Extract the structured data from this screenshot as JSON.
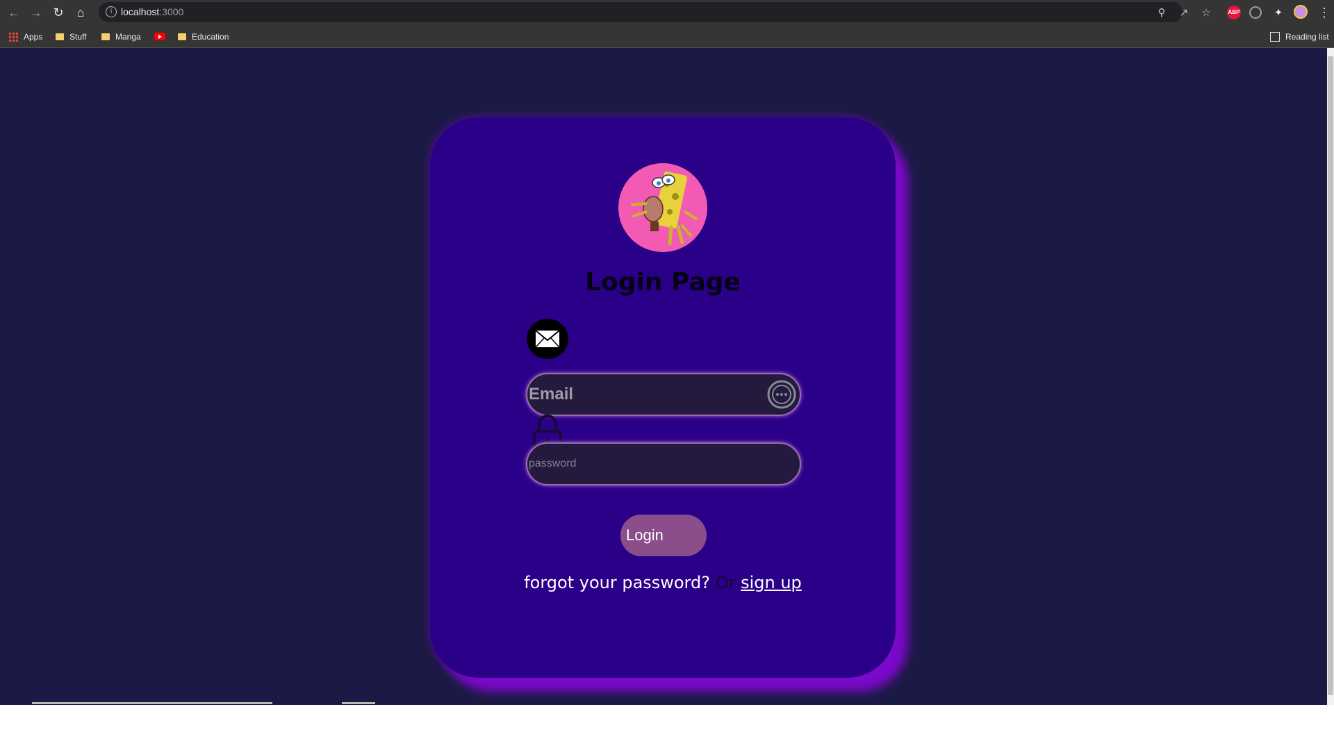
{
  "browser": {
    "url_host": "localhost",
    "url_port": ":3000",
    "bookmarks": {
      "apps": "Apps",
      "stuff": "Stuff",
      "manga": "Manga",
      "education": "Education"
    },
    "reading_list": "Reading list",
    "ext_abp": "ABP"
  },
  "page": {
    "title": "Login Page",
    "email_placeholder": "Email",
    "password_placeholder": "password",
    "login_button": "Login",
    "forgot_password": "forgot your password?",
    "or_text": "Or",
    "sign_up": "sign up"
  },
  "colors": {
    "page_background": "#1b1a44",
    "card_background": "#2b0088",
    "card_glow": "#7b09c9",
    "avatar_background": "#f25ab3",
    "login_button": "#8b4e8b"
  },
  "icons": {
    "email": "envelope-icon",
    "password": "lock-icon",
    "password_manager": "key-dots-icon"
  }
}
